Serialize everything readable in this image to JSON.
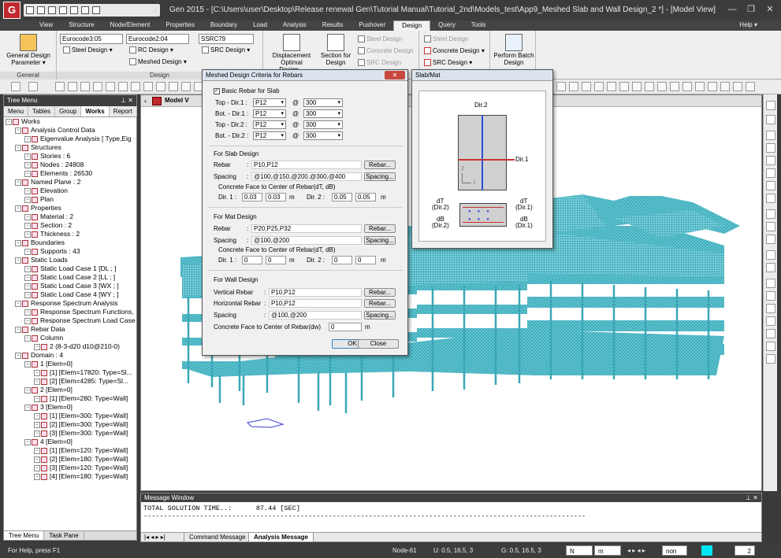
{
  "app": {
    "logo": "G",
    "window_title": "Gen 2015 - [C:\\Users\\user\\Desktop\\Release renewal Gen\\Tutorial Manual\\Tutorial_2nd\\Models_test\\App9_Meshed Slab and Wall Design_2 *] - [Model View]",
    "help": "Help"
  },
  "menu": [
    "View",
    "Structure",
    "Node/Element",
    "Properties",
    "Boundary",
    "Load",
    "Analysis",
    "Results",
    "Pushover",
    "Design",
    "Query",
    "Tools"
  ],
  "menu_active": "Design",
  "ribbon": {
    "general_btn": "General Design Parameter",
    "general_group": "General",
    "design_group": "Design",
    "combo1": "Eurocode3:05",
    "combo2": "Eurocode2:04",
    "combo3": "SSRC79",
    "steel_design": "Steel Design",
    "rc_design": "RC Design",
    "meshed_design": "Meshed Design",
    "src_design": "SRC Design",
    "displacement": "Displacement Optimal Design...",
    "section": "Section for Design",
    "steel_design2": "Steel Design",
    "concrete_design2": "Concrete Design",
    "src_design2": "SRC Design",
    "steel_design3": "Steel Design",
    "concrete_design3": "Concrete Design",
    "src_design3": "SRC Design",
    "perform": "Perform Batch Design"
  },
  "tree": {
    "header": "Tree Menu",
    "tabs": [
      "Menu",
      "Tables",
      "Group",
      "Works",
      "Report"
    ],
    "active_tab": "Works",
    "items": [
      "Works",
      "Analysis Control Data",
      "Eigenvalue Analysis [ Type,Eig",
      "Structures",
      "Stories : 6",
      "Nodes : 24808",
      "Elements : 26530",
      "Named Plane : 2",
      "Elevation",
      "Plan",
      "Properties",
      "Material : 2",
      "Section : 2",
      "Thickness : 2",
      "Boundaries",
      "Supports : 43",
      "Static Loads",
      "Static Load Case 1 [DL ; ]",
      "Static Load Case 2 [LL ; ]",
      "Static Load Case 3 [WX ; ]",
      "Static Load Case 4 [WY ; ]",
      "Response Spectrum Analysis",
      "Response Spectrum Functions,",
      "Response Spectrum Load Case",
      "Rebar Data",
      "Column",
      "2 (8-3-d20 d10@210-0)",
      "Domain : 4",
      "1 [Elem=0]",
      "[1] [Elem=17820: Type=Sl...",
      "[2] [Elem=4285: Type=Sl...",
      "2 [Elem=0]",
      "[1] [Elem=280: Type=Wall]",
      "3 [Elem=0]",
      "[1] [Elem=300: Type=Wall]",
      "[2] [Elem=300: Type=Wall]",
      "[3] [Elem=300: Type=Wall]",
      "4 [Elem=0]",
      "[1] [Elem=120: Type=Wall]",
      "[2] [Elem=180: Type=Wall]",
      "[3] [Elem=120: Type=Wall]",
      "[4] [Elem=180: Type=Wall]"
    ],
    "foot_tabs": [
      "Tree Menu",
      "Task Pane"
    ]
  },
  "view": {
    "tab_label": "Model V"
  },
  "dialog": {
    "title": "Meshed Design Criteria for Rebars",
    "basic_rebar": "Basic Rebar for Slab",
    "rows": [
      {
        "label": "Top - Dir.1 :",
        "bar": "P12",
        "at": "@",
        "spacing": "300"
      },
      {
        "label": "Bot. - Dir.1 :",
        "bar": "P12",
        "at": "@",
        "spacing": "300"
      },
      {
        "label": "Top - Dir.2 :",
        "bar": "P12",
        "at": "@",
        "spacing": "300"
      },
      {
        "label": "Bot. - Dir.2 :",
        "bar": "P12",
        "at": "@",
        "spacing": "300"
      }
    ],
    "slab_section": "For Slab Design",
    "rebar_label": "Rebar",
    "spacing_label": "Spacing",
    "colon": ":",
    "slab_rebar": "P10,P12",
    "slab_spacing": "@100,@150,@200,@300,@400",
    "concrete_face": "Concrete Face to Center of Rebar(dT, dB)",
    "dir1": "Dir. 1 :",
    "dir2": "Dir. 2 :",
    "m": "m",
    "slab_d1a": "0.03",
    "slab_d1b": "0.03",
    "slab_d2a": "0.05",
    "slab_d2b": "0.05",
    "mat_section": "For Mat Design",
    "mat_rebar": "P20,P25,P32",
    "mat_spacing": "@100,@200",
    "mat_d1a": "0",
    "mat_d1b": "0",
    "mat_d2a": "0",
    "mat_d2b": "0",
    "wall_section": "For Wall Design",
    "vert_label": "Vertical Rebar",
    "horiz_label": "Horizontal Rebar",
    "wall_vert": "P10,P12",
    "wall_horiz": "P10,P12",
    "wall_spacing": "@100,@200",
    "wall_face": "Concrete Face to  Center of Rebar(dw)",
    "wall_dw": "0",
    "rebar_btn": "Rebar...",
    "spacing_btn": "Spacing...",
    "ok": "OK",
    "close": "Close"
  },
  "slabmat": {
    "title": "Slab/Mat",
    "dir2": "Dir.2",
    "dir1": "Dir.1",
    "axis2": "2",
    "axis1": "1",
    "dT": "dT",
    "dir2p": "(Dir.2)",
    "dB": "dB",
    "dT_r": "dT",
    "dir1p": "(Dir.1)",
    "dB_r": "dB",
    "dir1p_b": "(Dir.1)",
    "dir2p_b": "(Dir.2)"
  },
  "message": {
    "title": "Message Window",
    "line1": "TOTAL SOLUTION TIME..:      87.44 [SEC]",
    "line2": "--------------------------------------------------------------------------------------------------------------",
    "tabs": [
      "Command Message",
      "Analysis Message"
    ],
    "active": "Analysis Message"
  },
  "status": {
    "help": "For Help, press F1",
    "node": "Node-61",
    "u": "U: 0.5, 16.5, 3",
    "g": "G: 0.5, 16.5, 3",
    "unit1": "N",
    "unit2": "m",
    "none": "non",
    "page": "2"
  },
  "colors": {
    "model": "#5bc6d4",
    "accent": "#c0282d"
  }
}
